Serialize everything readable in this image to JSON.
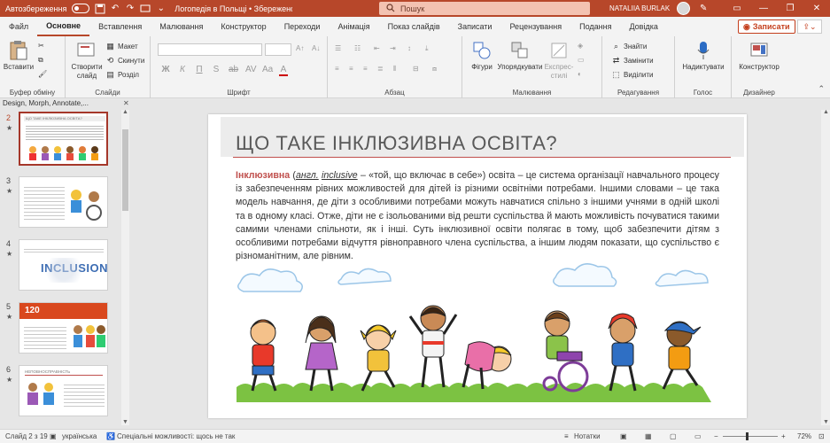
{
  "titlebar": {
    "autosave_label": "Автозбереження",
    "doc_title": "Логопедія в Польщі • Збережено у цей ПК",
    "search_placeholder": "Пошук",
    "user_name": "NATALIIA BURLAK"
  },
  "menu": {
    "tabs": [
      "Файл",
      "Основне",
      "Вставлення",
      "Малювання",
      "Конструктор",
      "Переходи",
      "Анімація",
      "Показ слайдів",
      "Записати",
      "Рецензування",
      "Подання",
      "Довідка"
    ],
    "active_index": 1,
    "record_label": "Записати"
  },
  "ribbon": {
    "clipboard": {
      "paste_label": "Вставити",
      "group_label": "Буфер обміну"
    },
    "slides": {
      "new_slide_label": "Створити слайд",
      "layout_label": "Макет",
      "reset_label": "Скинути",
      "section_label": "Розділ",
      "group_label": "Слайди"
    },
    "font": {
      "group_label": "Шрифт",
      "buttons": [
        "Ж",
        "К",
        "П",
        "S",
        "ab",
        "AV",
        "Aa",
        "A"
      ]
    },
    "paragraph": {
      "group_label": "Абзац"
    },
    "drawing": {
      "shapes_label": "Фігури",
      "arrange_label": "Упорядкувати",
      "styles_label": "Експрес-стилі",
      "group_label": "Малювання"
    },
    "editing": {
      "find_label": "Знайти",
      "replace_label": "Замінити",
      "select_label": "Виділити",
      "group_label": "Редагування"
    },
    "voice": {
      "dictate_label": "Надиктувати",
      "group_label": "Голос"
    },
    "designer": {
      "designer_label": "Конструктор",
      "group_label": "Дизайнер"
    }
  },
  "design_ideas_label": "Design, Morph, Annotate,...",
  "thumbnails": [
    {
      "num": "2",
      "star": "★",
      "selected": true
    },
    {
      "num": "3",
      "star": "★",
      "selected": false
    },
    {
      "num": "4",
      "star": "★",
      "selected": false
    },
    {
      "num": "5",
      "star": "★",
      "selected": false
    },
    {
      "num": "6",
      "star": "★",
      "selected": false
    }
  ],
  "thumb_texts": {
    "t2_title": "ЩО ТАКЕ ІНКЛЮЗИВНА ОСВІТА?",
    "t4_word": "INCLUSION",
    "t5_big": "120",
    "t6_title": "НЕПОВНОСПРАВНІСТЬ"
  },
  "slide": {
    "title": "ЩО ТАКЕ ІНКЛЮЗИВНА ОСВІТА?",
    "keyword": "Інклюзивна",
    "open_paren": " (",
    "abbr": "англ.",
    "space": " ",
    "term": "inclusive",
    "body_rest": " – «той, що включає в себе») освіта – це система організації навчального процесу із забезпеченням рівних можливостей для дітей із різними освітніми потребами.  Іншими словами – це така модель навчання, де діти з особливими потребами можуть навчатися спільно з іншими учнями в одній школі та в одному класі. Отже, діти не є ізольованими від решти суспільства й мають можливість почуватися такими самими членами спільноти, як і інші. Суть інклюзивної освіти полягає в тому, щоб забезпечити дітям з особливими потребами відчуття рівноправного члена суспільства, а іншим людям показати, що суспільство є різноманітним, але рівним."
  },
  "statusbar": {
    "slide_of": "Слайд 2 з 19",
    "language": "українська",
    "accessibility": "Спеціальні можливості: щось не так",
    "notes": "Нотатки",
    "zoom": "72%"
  },
  "colors": {
    "accent": "#b7472a",
    "title_red": "#c0504d"
  }
}
